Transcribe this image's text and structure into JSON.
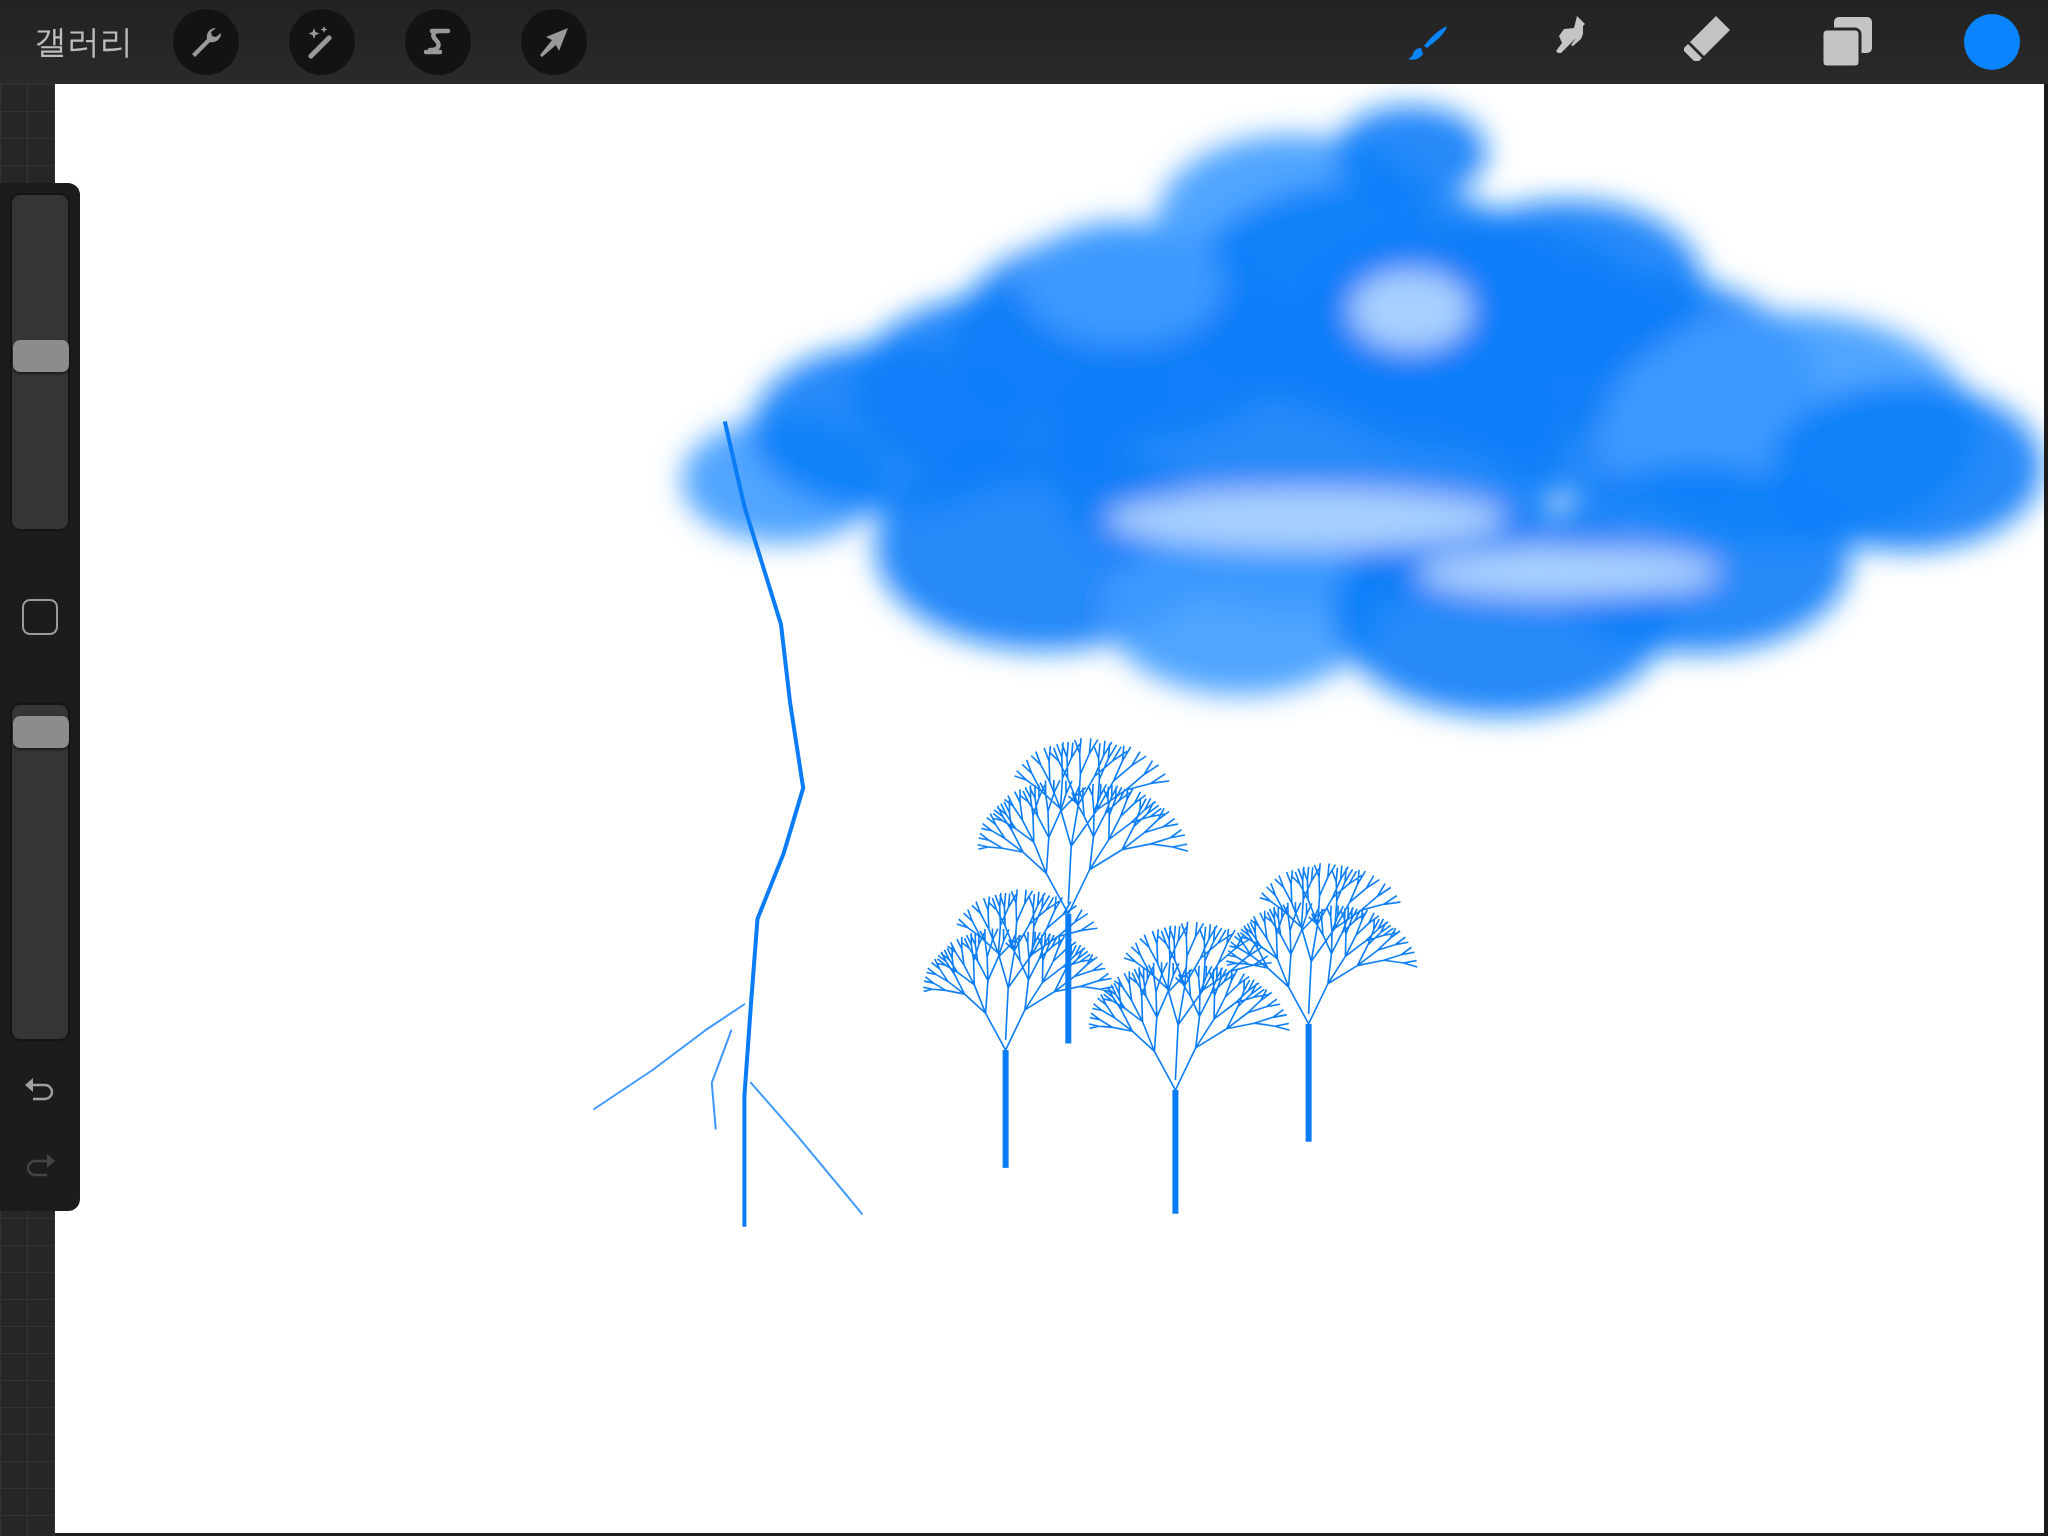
{
  "top_bar": {
    "gallery": "갤러리",
    "actions": [
      {
        "kind": "wrench"
      },
      {
        "kind": "wand"
      },
      {
        "kind": "selection"
      },
      {
        "kind": "transform"
      }
    ],
    "tools": [
      {
        "kind": "brush",
        "selected": true
      },
      {
        "kind": "smudge",
        "selected": false
      },
      {
        "kind": "eraser",
        "selected": false
      },
      {
        "kind": "layers",
        "selected": false
      }
    ],
    "color": "#0a84ff"
  },
  "sidebar": {
    "size": {
      "level": 0.52
    },
    "opacity": {
      "level": 0.97
    },
    "undo": {
      "disabled": false
    },
    "redo": {
      "disabled": true
    }
  },
  "canvas": {
    "kind": "drawing"
  }
}
